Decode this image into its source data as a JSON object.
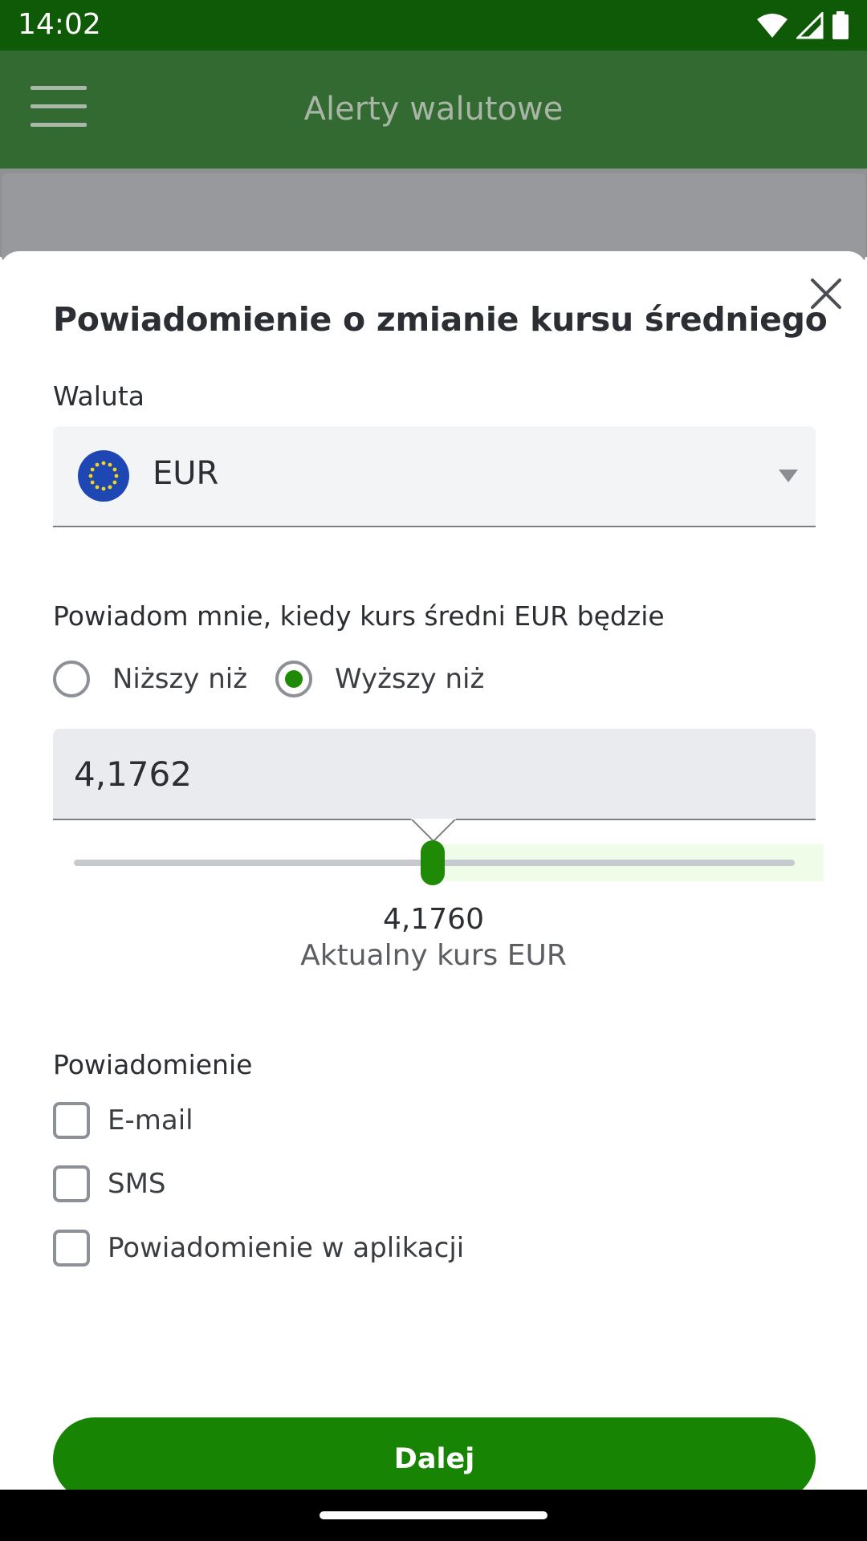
{
  "status_bar": {
    "time": "14:02",
    "icons": [
      "wifi-icon",
      "signal-icon",
      "battery-icon"
    ]
  },
  "header": {
    "title": "Alerty walutowe",
    "menu_icon": "hamburger-menu-icon",
    "color": "#336a31"
  },
  "dialog": {
    "title": "Powiadomienie o zmianie kursu średniego",
    "close_icon": "close-icon",
    "currency": {
      "label": "Waluta",
      "value": "EUR",
      "flag_icon": "eu-flag-icon"
    },
    "condition": {
      "label": "Powiadom mnie, kiedy kurs średni EUR będzie",
      "options": [
        {
          "label": "Niższy niż",
          "selected": false
        },
        {
          "label": "Wyższy niż",
          "selected": true
        }
      ]
    },
    "threshold": {
      "value": "4,1762"
    },
    "slider": {
      "position_fraction": 0.5
    },
    "current_rate": {
      "value": "4,1760",
      "label": "Aktualny kurs EUR"
    },
    "notification": {
      "label": "Powiadomienie",
      "channels": [
        {
          "label": "E-mail",
          "checked": false
        },
        {
          "label": "SMS",
          "checked": false
        },
        {
          "label": "Powiadomienie w aplikacji",
          "checked": false
        }
      ]
    },
    "next_button": "Dalej"
  },
  "colors": {
    "primary": "#188403",
    "status_bar": "#0e5a06"
  }
}
